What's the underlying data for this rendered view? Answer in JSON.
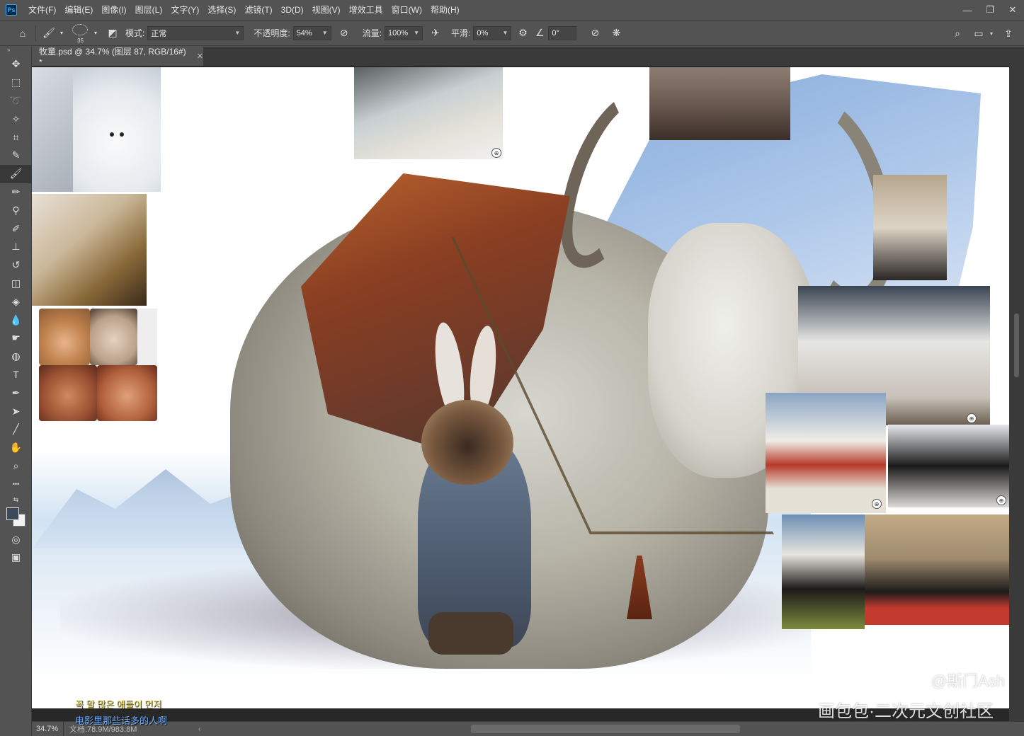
{
  "app": {
    "logo": "Ps"
  },
  "menu": [
    "文件(F)",
    "编辑(E)",
    "图像(I)",
    "图层(L)",
    "文字(Y)",
    "选择(S)",
    "滤镜(T)",
    "3D(D)",
    "视图(V)",
    "增效工具",
    "窗口(W)",
    "帮助(H)"
  ],
  "window_controls": {
    "minimize": "—",
    "maximize": "❐",
    "close": "✕"
  },
  "options": {
    "brush_size": "35",
    "mode_label": "模式:",
    "mode_value": "正常",
    "opacity_label": "不透明度:",
    "opacity_value": "54%",
    "flow_label": "流量:",
    "flow_value": "100%",
    "smoothing_label": "平滑:",
    "smoothing_value": "0%",
    "angle_value": "0°"
  },
  "tab": {
    "title": "牧童.psd @ 34.7% (图层 87, RGB/16#) *",
    "close": "✕"
  },
  "tools": [
    {
      "name": "move-tool",
      "icon": "✥"
    },
    {
      "name": "marquee-tool",
      "icon": "⬚"
    },
    {
      "name": "lasso-tool",
      "icon": "➰"
    },
    {
      "name": "magic-wand-tool",
      "icon": "✧"
    },
    {
      "name": "crop-tool",
      "icon": "⌗"
    },
    {
      "name": "eyedropper-tool",
      "icon": "✎"
    },
    {
      "name": "brush-tool",
      "icon": "🖌"
    },
    {
      "name": "pencil-tool",
      "icon": "✏"
    },
    {
      "name": "clone-stamp-tool",
      "icon": "⚲"
    },
    {
      "name": "mixer-brush-tool",
      "icon": "✐"
    },
    {
      "name": "stamp-tool",
      "icon": "⊥"
    },
    {
      "name": "history-brush-tool",
      "icon": "↺"
    },
    {
      "name": "eraser-tool",
      "icon": "◫"
    },
    {
      "name": "paint-bucket-tool",
      "icon": "◈"
    },
    {
      "name": "blur-tool",
      "icon": "💧"
    },
    {
      "name": "smudge-tool",
      "icon": "☛"
    },
    {
      "name": "sponge-tool",
      "icon": "◍"
    },
    {
      "name": "type-tool",
      "icon": "T"
    },
    {
      "name": "pen-tool",
      "icon": "✒"
    },
    {
      "name": "path-select-tool",
      "icon": "➤"
    },
    {
      "name": "line-tool",
      "icon": "╱"
    },
    {
      "name": "hand-tool",
      "icon": "✋"
    },
    {
      "name": "zoom-tool",
      "icon": "⌕"
    },
    {
      "name": "more-tools",
      "icon": "•••"
    }
  ],
  "watermark": {
    "handle": "@斯门Ash",
    "site": "画包包·二次元文创社区"
  },
  "subtitles": {
    "korean": "꼭 말 많은 애들이 먼저",
    "chinese": "电影里那些话多的人啊"
  },
  "status": {
    "zoom": "34.7%",
    "doc": "文档:78.9M/983.8M"
  }
}
